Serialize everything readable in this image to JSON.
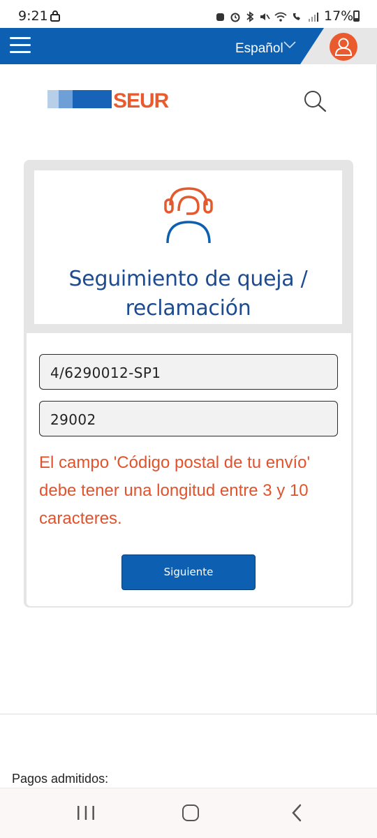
{
  "status_bar": {
    "time": "9:21",
    "battery": "17%"
  },
  "header": {
    "language": "Español",
    "colors": {
      "primary": "#0c5fb1",
      "accent": "#ea5a2f"
    },
    "icons": [
      "menu-icon",
      "chevron-down-icon",
      "user-icon"
    ]
  },
  "brand": {
    "logo_text": "SEUR"
  },
  "card": {
    "title_line1": "Seguimiento de queja /",
    "title_line2": "reclamación",
    "tracking_value": "4/6290012-SP1",
    "postal_value": "29002",
    "error_message": "El campo 'Código postal de tu envío' debe tener una longitud entre 3 y 10 caracteres.",
    "next_label": "Siguiente",
    "error_color": "#e0532d"
  },
  "footer": {
    "payments_label": "Pagos admitidos:"
  }
}
